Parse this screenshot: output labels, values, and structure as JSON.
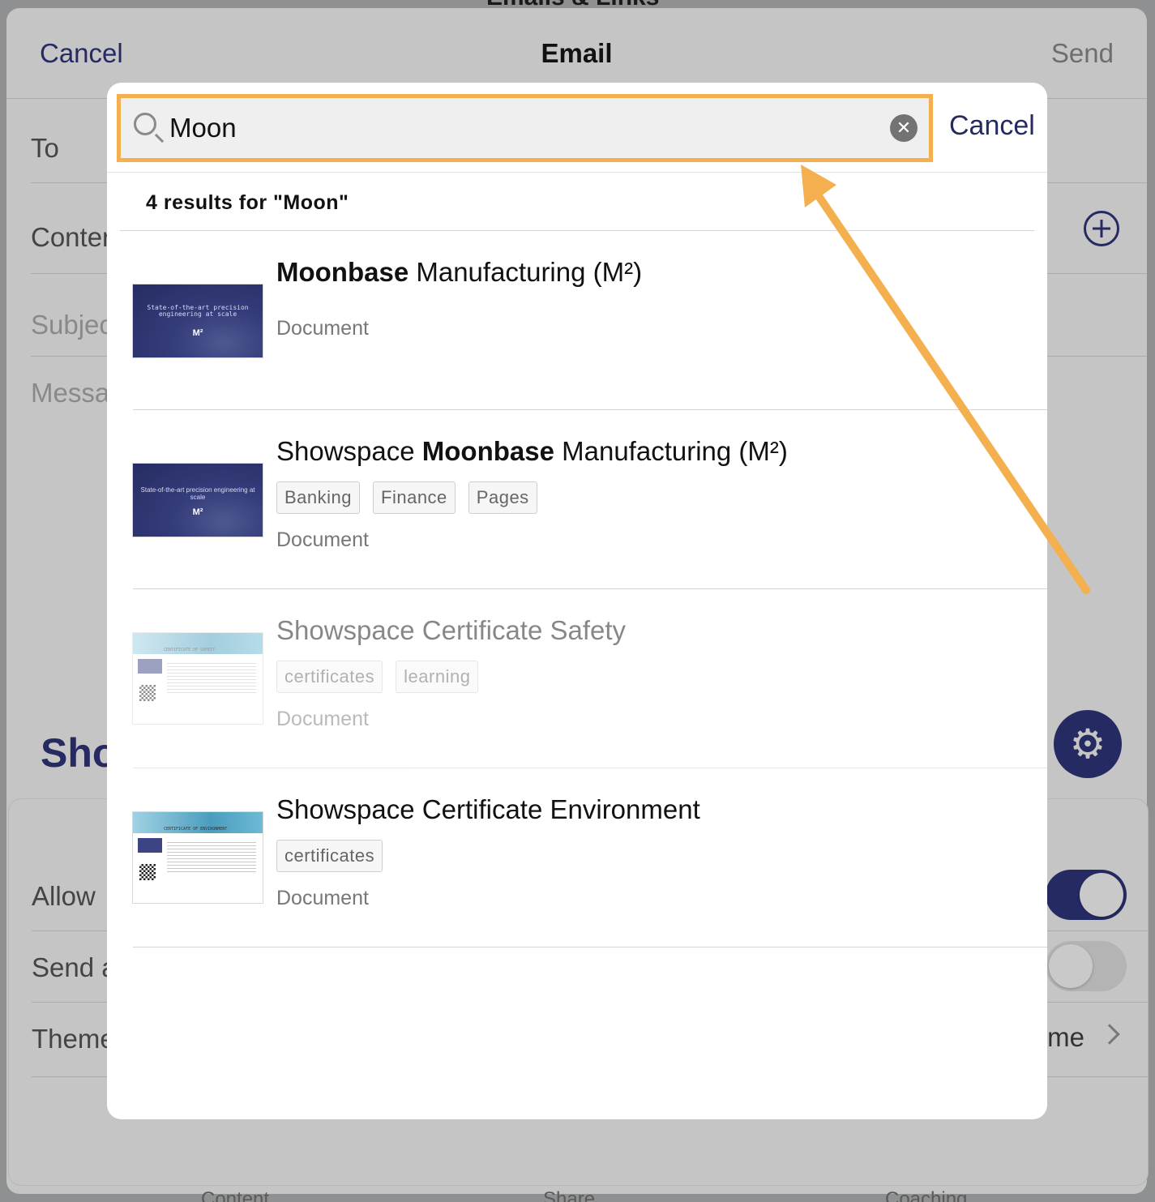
{
  "background": {
    "peek_title": "Emails & Links",
    "email_sheet": {
      "cancel": "Cancel",
      "title": "Email",
      "send": "Send",
      "rows": {
        "to": "To",
        "content": "Content",
        "subject": "Subject",
        "message": "Message"
      },
      "brand_peek": "Showspace"
    },
    "settings_sheet": {
      "allow": "Allow",
      "send": "Send a",
      "theme": "Theme",
      "theme_value": "Theme"
    },
    "bottom_tabs": {
      "content": "Content",
      "share": "Share",
      "coaching": "Coaching"
    }
  },
  "search": {
    "query": "Moon",
    "cancel": "Cancel",
    "results_summary": "4 results for \"Moon\"",
    "results": [
      {
        "title_pre": "",
        "title_match": "Moonbase",
        "title_post": " Manufacturing (M²)",
        "tags": [],
        "type": "Document",
        "thumb_line1": "State-of-the-art precision",
        "thumb_line2": "engineering at scale",
        "thumb_mark": "M²"
      },
      {
        "title_pre": "Showspace ",
        "title_match": "Moonbase",
        "title_post": " Manufacturing (M²)",
        "tags": [
          "Banking",
          "Finance",
          "Pages"
        ],
        "type": "Document",
        "thumb_line1": "State-of-the-art precision engineering at scale",
        "thumb_line2": "",
        "thumb_mark": "M²"
      },
      {
        "title_pre": "Showspace Certificate Safety",
        "title_match": "",
        "title_post": "",
        "tags": [
          "certificates",
          "learning"
        ],
        "type": "Document",
        "thumb_head": "CERTIFICATE OF SAFETY"
      },
      {
        "title_pre": "Showspace Certificate Environment",
        "title_match": "",
        "title_post": "",
        "tags": [
          "certificates"
        ],
        "type": "Document",
        "thumb_head": "CERTIFICATE OF ENVIRONMENT"
      }
    ]
  },
  "colors": {
    "accent": "#262a63",
    "highlight": "#f4b04f"
  },
  "icons": {
    "search": "search-icon",
    "clear": "clear-icon",
    "plus": "plus-circle-icon",
    "gear": "gear-icon",
    "chevron": "chevron-right-icon"
  }
}
